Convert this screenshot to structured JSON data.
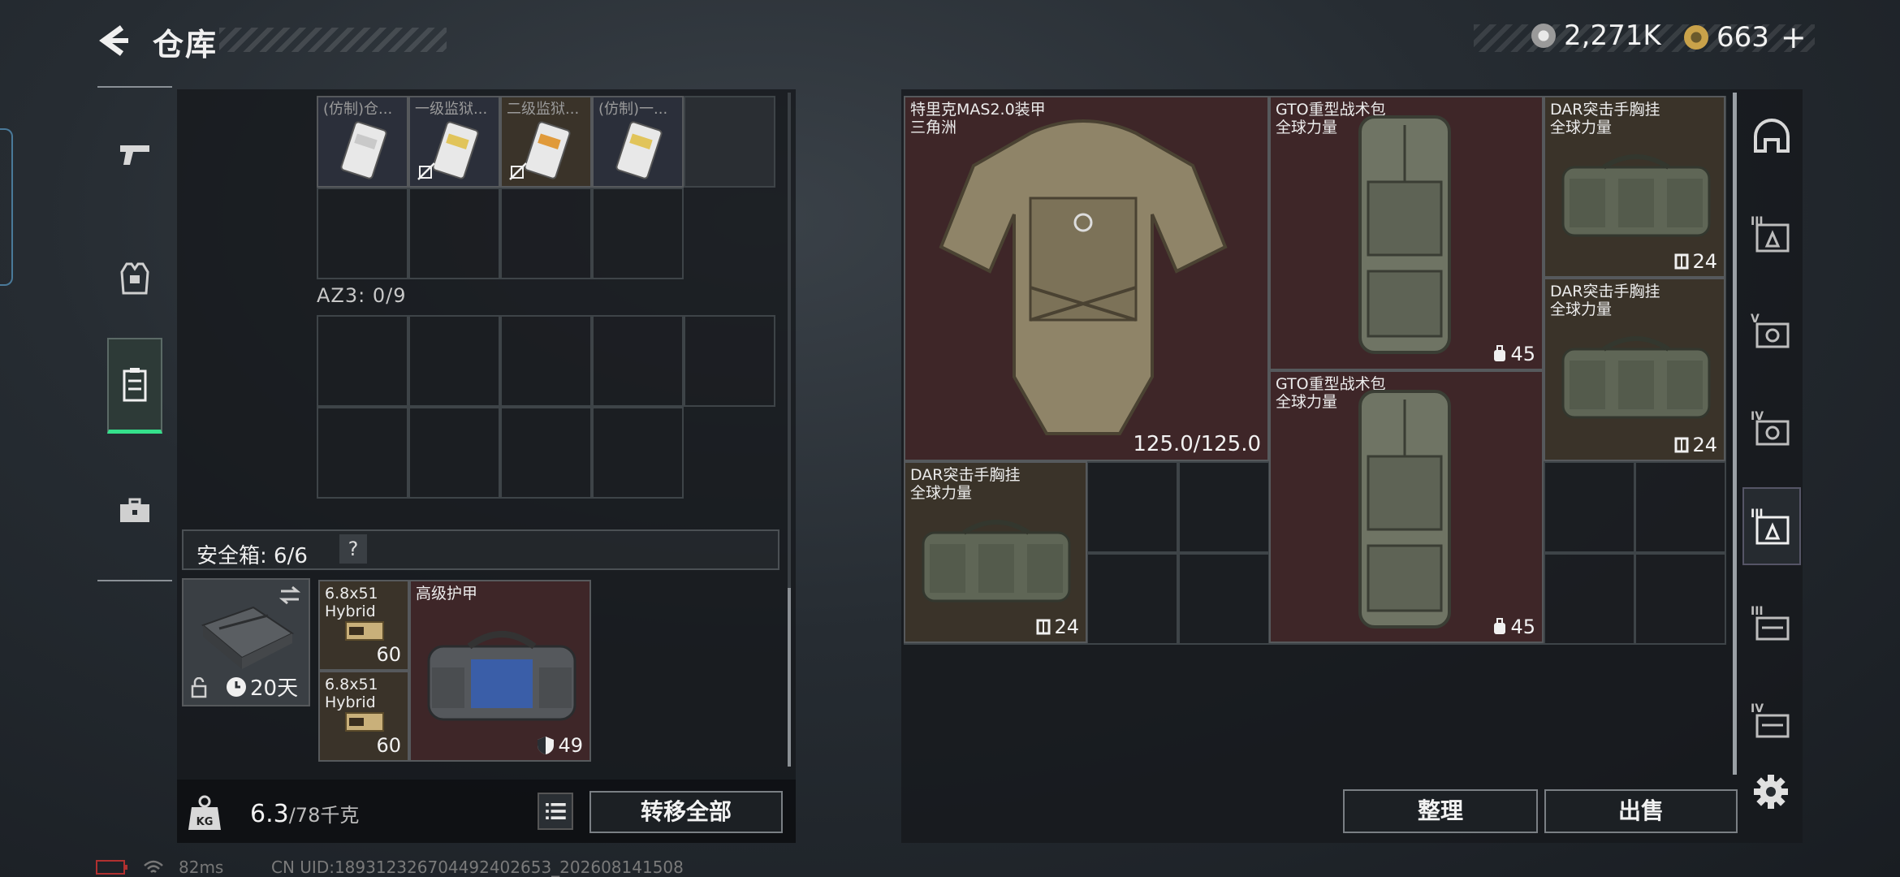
{
  "header": {
    "title": "仓库",
    "currency1": "2,271K",
    "currency2": "663",
    "add_symbol": "+"
  },
  "left_nav": {
    "items": [
      "pistol-icon",
      "armor-vest-icon",
      "chest-rig-icon",
      "briefcase-icon"
    ],
    "active": 2
  },
  "top_container": {
    "items": [
      {
        "name": "(仿制)仓...",
        "locked": false
      },
      {
        "name": "一级监狱...",
        "locked": true
      },
      {
        "name": "二级监狱...",
        "locked": true
      },
      {
        "name": "(仿制)一...",
        "locked": false
      }
    ]
  },
  "az3": {
    "label": "AZ3: 0/9"
  },
  "safe_box": {
    "label": "安全箱: 6/6",
    "help": "?",
    "timer": "20天",
    "items": [
      {
        "name": "6.8x51\nHybrid",
        "value": "60"
      },
      {
        "name": "6.8x51\nHybrid",
        "value": "60"
      },
      {
        "name": "高级护甲",
        "value": "49"
      }
    ]
  },
  "right_grid": {
    "items": [
      {
        "name": "特里克MAS2.0装甲\n三角洲",
        "value": "125.0/125.0"
      },
      {
        "name": "GTO重型战术包\n全球力量",
        "value": "45"
      },
      {
        "name": "DAR突击手胸挂\n全球力量",
        "value": "24"
      },
      {
        "name": "DAR突击手胸挂\n全球力量",
        "value": "24"
      },
      {
        "name": "GTO重型战术包\n全球力量",
        "value": "45"
      },
      {
        "name": "DAR突击手胸挂\n全球力量",
        "value": "24"
      }
    ]
  },
  "bottom": {
    "weight_current": "6.3",
    "weight_max": "/78千克",
    "transfer_all": "转移全部",
    "sort": "整理",
    "sell": "出售"
  },
  "right_nav": {
    "items": [
      "helmet-icon",
      "tier3-armor-icon",
      "tier5-weapon-icon",
      "tier4-weapon-icon",
      "tier3-armor-selected-icon",
      "tier3-case-icon",
      "tier4-case-icon"
    ],
    "active": 4
  },
  "status": {
    "ping": "82ms",
    "uid": "CN UID:1893123267044924026​53_202608141508"
  },
  "colors": {
    "accent_green": "#35e08c",
    "item_red": "#3e2628",
    "item_brown": "#3a3329"
  }
}
